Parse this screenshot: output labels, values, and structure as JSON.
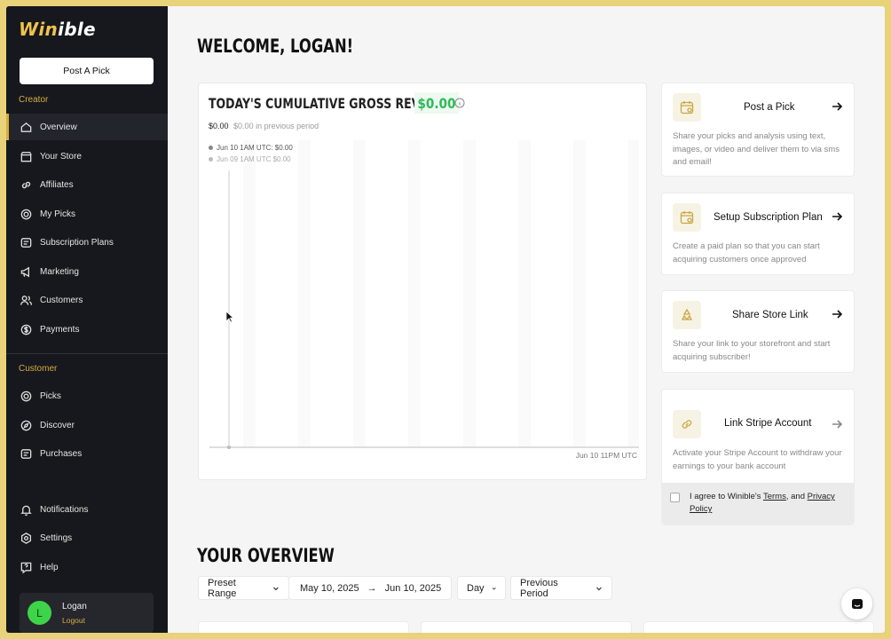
{
  "app": {
    "logo_text": "Winible"
  },
  "sidebar": {
    "post_button": "Post A Pick",
    "creator_label": "Creator",
    "creator_items": [
      {
        "label": "Overview",
        "icon": "home-icon",
        "active": true
      },
      {
        "label": "Your Store",
        "icon": "store-icon"
      },
      {
        "label": "Affiliates",
        "icon": "link-icon"
      },
      {
        "label": "My Picks",
        "icon": "target-icon"
      },
      {
        "label": "Subscription Plans",
        "icon": "plans-icon"
      },
      {
        "label": "Marketing",
        "icon": "megaphone-icon"
      },
      {
        "label": "Customers",
        "icon": "users-icon"
      },
      {
        "label": "Payments",
        "icon": "dollar-icon"
      }
    ],
    "customer_label": "Customer",
    "customer_items": [
      {
        "label": "Picks",
        "icon": "target-icon"
      },
      {
        "label": "Discover",
        "icon": "compass-icon"
      },
      {
        "label": "Purchases",
        "icon": "plans-icon"
      }
    ],
    "bottom_items": [
      {
        "label": "Notifications",
        "icon": "bell-icon"
      },
      {
        "label": "Settings",
        "icon": "gear-icon"
      },
      {
        "label": "Help",
        "icon": "help-icon"
      }
    ],
    "user": {
      "initial": "L",
      "name": "Logan",
      "logout": "Logout"
    }
  },
  "main": {
    "welcome": "WELCOME, LOGAN!",
    "revenue": {
      "title": "TODAY'S CUMULATIVE GROSS REVENUE",
      "amount": "$0.00",
      "current": "$0.00",
      "previous": "$0.00 in previous period",
      "tooltip_current": "Jun 10 1AM UTC: $0.00",
      "tooltip_previous": "Jun 09 1AM UTC $0.00",
      "x_end_label": "Jun 10 11PM UTC"
    },
    "actions": [
      {
        "title": "Post a Pick",
        "desc": "Share your picks and analysis using text, images, or video and deliver them to via sms and email!",
        "icon": "calendar-icon"
      },
      {
        "title": "Setup Subscription Plan",
        "desc": "Create a paid plan so that you can start acquiring customers once approved",
        "icon": "calendar-icon"
      },
      {
        "title": "Share Store Link",
        "desc": "Share your link to your storefront and start acquiring subscriber!",
        "icon": "recycle-icon"
      },
      {
        "title": "Link Stripe Account",
        "desc": "Activate your Stripe Account to withdraw your earnings to your bank account",
        "icon": "link-icon"
      }
    ],
    "agree": {
      "prefix": "I agree to Winible's ",
      "terms": "Terms",
      "middle": ", and ",
      "privacy": "Privacy Policy"
    },
    "overview": {
      "title": "YOUR OVERVIEW",
      "preset": "Preset Range",
      "date_from": "May 10, 2025",
      "arrow": "→",
      "date_to": "Jun 10, 2025",
      "granularity": "Day",
      "compare": "Previous Period"
    }
  },
  "colors": {
    "accent": "#d6ad3f",
    "sidebar_bg": "#16181d",
    "positive": "#2dbb56"
  }
}
